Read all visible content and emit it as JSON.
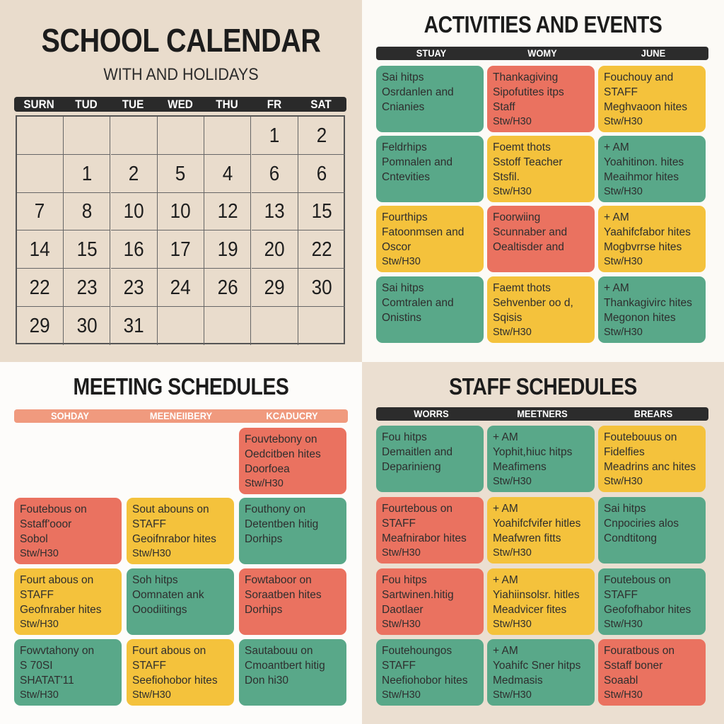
{
  "calendar": {
    "title": "SCHOOL CALENDAR",
    "subtitle": "WITH AND HOLIDAYS",
    "days": [
      "SURN",
      "TUD",
      "TUE",
      "WED",
      "THU",
      "FR",
      "SAT"
    ],
    "rows": [
      [
        "",
        "",
        "",
        "",
        "",
        "1",
        "2"
      ],
      [
        "",
        "1",
        "2",
        "5",
        "4",
        "6",
        "6"
      ],
      [
        "7",
        "8",
        "10",
        "10",
        "12",
        "13",
        "15"
      ],
      [
        "14",
        "15",
        "16",
        "17",
        "19",
        "20",
        "22"
      ],
      [
        "22",
        "23",
        "23",
        "24",
        "26",
        "29",
        "30"
      ],
      [
        "29",
        "30",
        "31",
        "",
        "",
        "",
        ""
      ]
    ]
  },
  "activities": {
    "title": "ACTIVITIES AND EVENTS",
    "headers": [
      "STUAY",
      "WOMY",
      "JUNE"
    ],
    "header_color": "#2c2c2c",
    "header_text_color": "#ffffff",
    "cards": [
      {
        "color": "green",
        "lines": [
          "Sai hitps",
          "Osrdanlen and",
          "Cnianies"
        ]
      },
      {
        "color": "red",
        "lines": [
          "Thankagiving",
          "Sipofutites itps",
          "Staff",
          "Stw/H30"
        ]
      },
      {
        "color": "yellow",
        "lines": [
          "Fouchouy and",
          "STAFF",
          "Meghvaoon hites",
          "Stw/H30"
        ]
      },
      {
        "color": "green",
        "lines": [
          "Feldrhips",
          "Pomnalen and",
          "Cntevities"
        ]
      },
      {
        "color": "yellow",
        "lines": [
          "Foemt thots",
          "Sstoff Teacher",
          "Stsfil.",
          "Stw/H30"
        ]
      },
      {
        "color": "green",
        "lines": [
          "+ AM",
          "Yoahitinon. hites",
          "Meaihmor hites",
          "Stw/H30"
        ]
      },
      {
        "color": "yellow",
        "lines": [
          "Fourthips",
          "Fatoonmsen and",
          "Oscor",
          "Stw/H30"
        ]
      },
      {
        "color": "red",
        "lines": [
          "Foorwiing",
          "Scunnaber and",
          "Oealtisder and"
        ]
      },
      {
        "color": "yellow",
        "lines": [
          "+ AM",
          "Yaahifcfabor hites",
          "Mogbvrrse hites",
          "Stw/H30"
        ]
      },
      {
        "color": "green",
        "lines": [
          "Sai hitps",
          "Comtralen and",
          "Onistins"
        ]
      },
      {
        "color": "yellow",
        "lines": [
          "Faemt thots",
          "Sehvenber oo d,",
          "Sqisis",
          "Stw/H30"
        ]
      },
      {
        "color": "green",
        "lines": [
          "+ AM",
          "Thankagivirc hites",
          "Megonon hites",
          "Stw/H30"
        ]
      }
    ]
  },
  "meeting": {
    "title": "MEETING SCHEDULES",
    "headers": [
      "SOHDAY",
      "MEENEIIBERY",
      "KCADUCRY"
    ],
    "header_color": "#f09a7e",
    "header_text_color": "#ffffff",
    "cards": [
      {
        "col": 2,
        "row": 0,
        "color": "red",
        "lines": [
          "Fouvtebony on",
          "Oedcitben hites",
          "Doorfoea",
          "Stw/H30"
        ]
      },
      {
        "col": 0,
        "row": 1,
        "color": "red",
        "lines": [
          "Foutebous on",
          "Sstaff'ooor",
          "Sobol",
          "Stw/H30"
        ]
      },
      {
        "col": 1,
        "row": 1,
        "color": "yellow",
        "lines": [
          "Sout abouns on",
          "STAFF",
          "Geoifnrabor hites",
          "Stw/H30"
        ]
      },
      {
        "col": 2,
        "row": 1,
        "color": "green",
        "lines": [
          "Fouthony on",
          "Detentben hitig",
          "Dorhips"
        ]
      },
      {
        "col": 0,
        "row": 2,
        "color": "yellow",
        "lines": [
          "Fourt abous on",
          "STAFF",
          "Geofnraber hites",
          "Stw/H30"
        ]
      },
      {
        "col": 1,
        "row": 2,
        "color": "green",
        "lines": [
          "Soh hitps",
          "Oomnaten ank",
          "Ooodiitings"
        ]
      },
      {
        "col": 2,
        "row": 2,
        "color": "red",
        "lines": [
          "Fowtaboor on",
          "Soraatben hites",
          "Dorhips"
        ]
      },
      {
        "col": 0,
        "row": 3,
        "color": "green",
        "lines": [
          "Fowvtahony on",
          "S 70SI",
          "SHATAT'11",
          "Stw/H30"
        ]
      },
      {
        "col": 1,
        "row": 3,
        "color": "yellow",
        "lines": [
          "Fourt abous on",
          "STAFF",
          "Seefiohobor hites",
          "Stw/H30"
        ]
      },
      {
        "col": 2,
        "row": 3,
        "color": "green",
        "lines": [
          "Sautabouu on",
          "Cmoantbert hitig",
          "Don hi30"
        ]
      }
    ]
  },
  "staff": {
    "title": "STAFF SCHEDULES",
    "headers": [
      "WORRS",
      "MEETNERS",
      "BREARS"
    ],
    "header_color": "#2c2c2c",
    "header_text_color": "#ffffff",
    "cards": [
      {
        "color": "green",
        "lines": [
          "Fou hitps",
          "Demaitlen and",
          "Deparinieng"
        ]
      },
      {
        "color": "green",
        "lines": [
          "+ AM",
          "Yophit,hiuc hitps",
          "Meafimens",
          "Stw/H30"
        ]
      },
      {
        "color": "yellow",
        "lines": [
          "Foutebouus on",
          "Fidelfies",
          "Meadrins anc hites",
          "Stw/H30"
        ]
      },
      {
        "color": "red",
        "lines": [
          "Fourtebous on",
          "STAFF",
          "Meafnirabor hites",
          "Stw/H30"
        ]
      },
      {
        "color": "yellow",
        "lines": [
          "+ AM",
          "Yoahifcfvifer hitles",
          "Meafwren fitts",
          "Stw/H30"
        ]
      },
      {
        "color": "green",
        "lines": [
          "Sai hitps",
          "Cnpociries alos",
          "Condtitong"
        ]
      },
      {
        "color": "red",
        "lines": [
          "Fou hitps",
          "Sartwinen.hitig",
          "Daotlaer",
          "Stw/H30"
        ]
      },
      {
        "color": "yellow",
        "lines": [
          "+ AM",
          "Yiahiinsolsr. hitles",
          "Meadvicer fites",
          "Stw/H30"
        ]
      },
      {
        "color": "green",
        "lines": [
          "Foutebous on",
          "STAFF",
          "Geofofhabor hites",
          "Stw/H30"
        ]
      },
      {
        "color": "green",
        "lines": [
          "Foutehoungos",
          "STAFF",
          "Neefiohobor hites",
          "Stw/H30"
        ]
      },
      {
        "color": "green",
        "lines": [
          "+ AM",
          "Yoahifc Sner hitps",
          "Medmasis",
          "Stw/H30"
        ]
      },
      {
        "color": "red",
        "lines": [
          "Fouratbous on",
          "Sstaff boner",
          "Soaabl",
          "Stw/H30"
        ]
      }
    ]
  }
}
